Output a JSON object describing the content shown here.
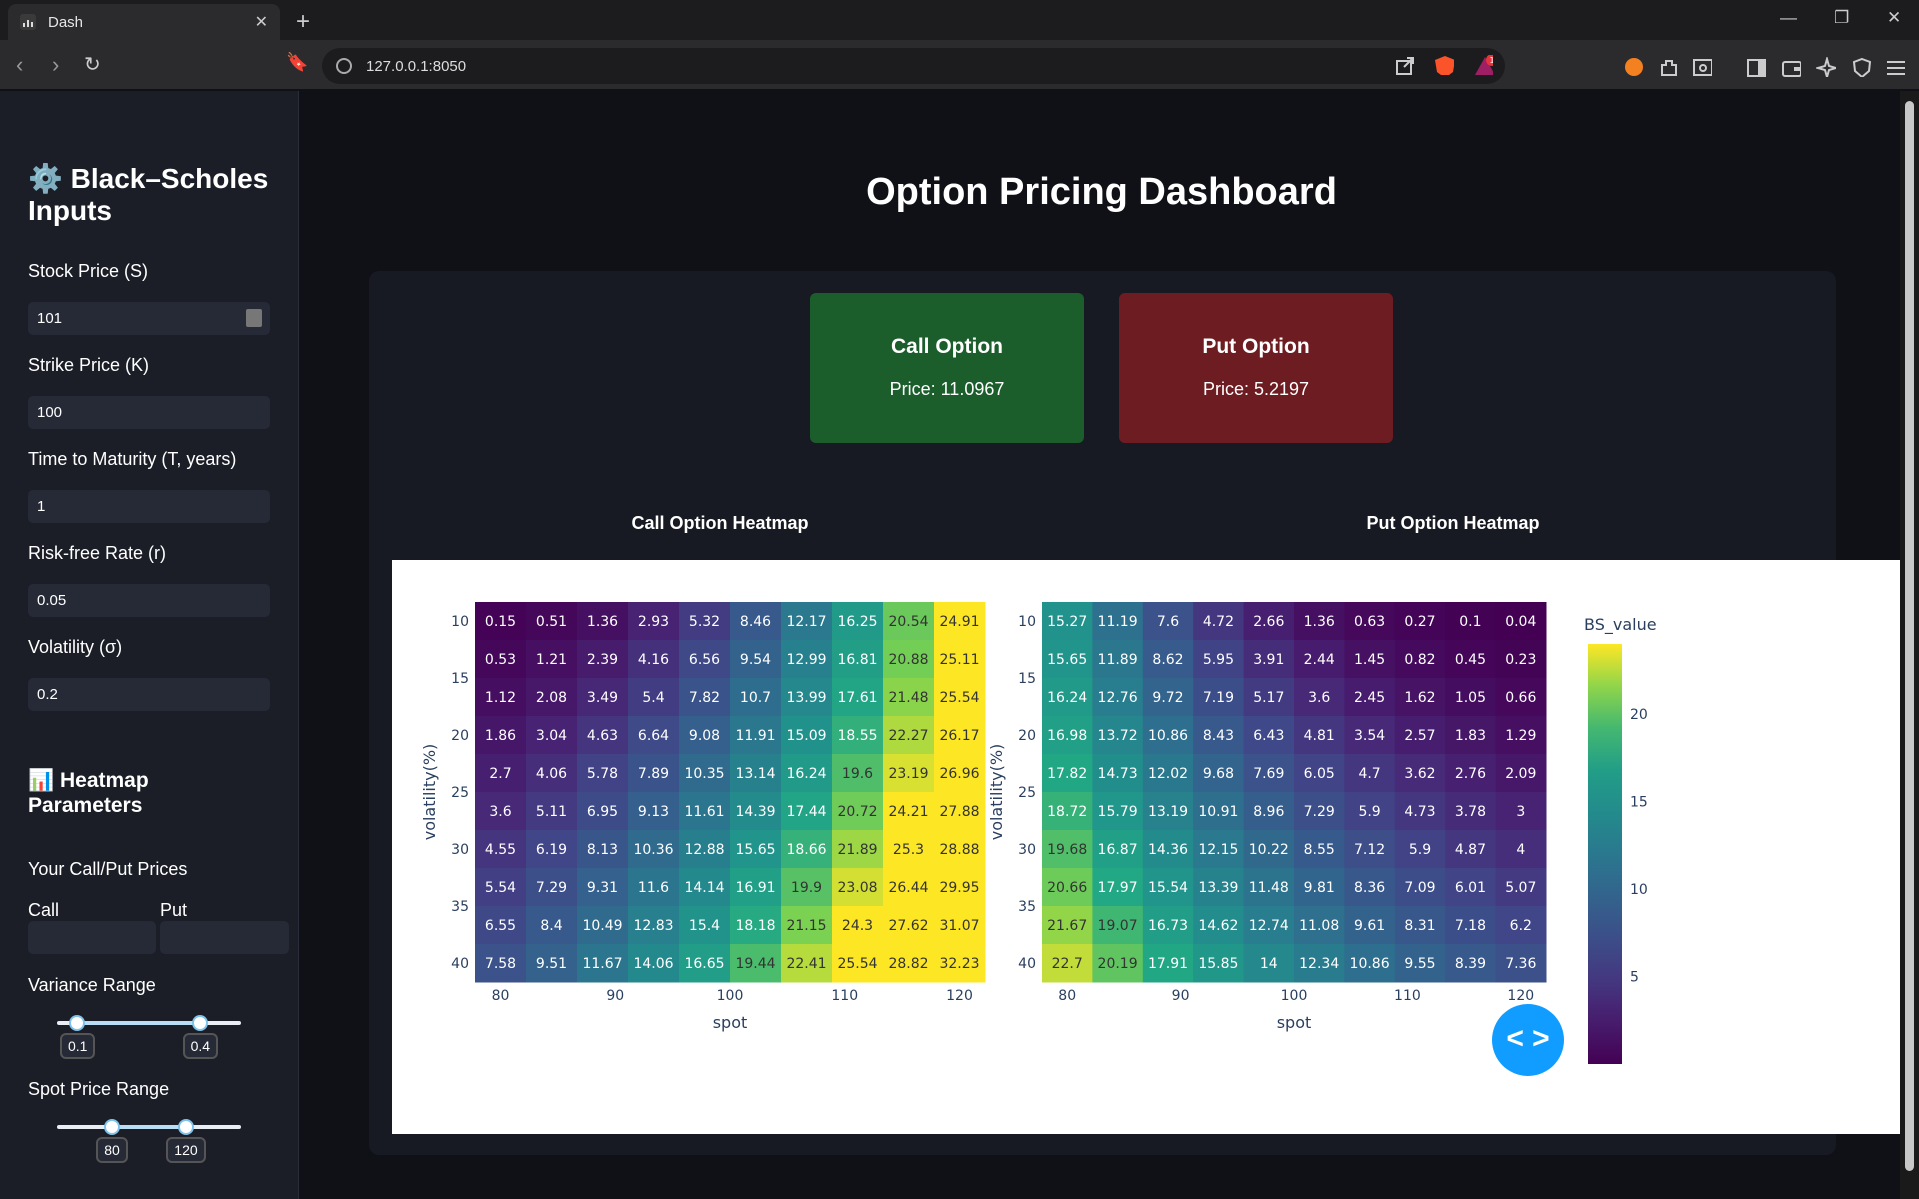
{
  "browser": {
    "tab_title": "Dash",
    "url": "127.0.0.1:8050",
    "notification_count": "1"
  },
  "sidebar": {
    "title": "⚙️ Black–Scholes Inputs",
    "fields": [
      {
        "label": "Stock Price (S)",
        "value": "101"
      },
      {
        "label": "Strike Price (K)",
        "value": "100"
      },
      {
        "label": "Time to Maturity (T, years)",
        "value": "1"
      },
      {
        "label": "Risk-free Rate (r)",
        "value": "0.05"
      },
      {
        "label": "Volatility (σ)",
        "value": "0.2"
      }
    ],
    "heatmap_title": "📊 Heatmap Parameters",
    "your_prices_label": "Your Call/Put Prices",
    "call_label": "Call",
    "put_label": "Put",
    "variance_range_label": "Variance Range",
    "variance_range": {
      "low": "0.1",
      "high": "0.4",
      "min": 0.05,
      "max": 0.5
    },
    "spot_range_label": "Spot Price Range",
    "spot_range": {
      "low": "80",
      "high": "120",
      "min": 50,
      "max": 150
    }
  },
  "main": {
    "title": "Option Pricing Dashboard",
    "call_card": {
      "title": "Call Option",
      "price": "Price: 11.0967",
      "color": "#1b5e2c"
    },
    "put_card": {
      "title": "Put Option",
      "price": "Price: 5.2197",
      "color": "#6d1c22"
    },
    "call_heatmap_title": "Call Option Heatmap",
    "put_heatmap_title": "Put Option Heatmap"
  },
  "chart_data": [
    {
      "type": "heatmap",
      "title": "Call Option Heatmap",
      "xlabel": "spot",
      "ylabel": "volatility(%)",
      "x_ticks": [
        "80",
        "90",
        "100",
        "110",
        "120"
      ],
      "y_ticks": [
        "10",
        "15",
        "20",
        "25",
        "30",
        "35",
        "40"
      ],
      "colorscale": "viridis",
      "zlim": [
        0,
        24
      ],
      "values": [
        [
          0.15,
          0.51,
          1.36,
          2.93,
          5.32,
          8.46,
          12.17,
          16.25,
          20.54,
          24.91
        ],
        [
          0.53,
          1.21,
          2.39,
          4.16,
          6.56,
          9.54,
          12.99,
          16.81,
          20.88,
          25.11
        ],
        [
          1.12,
          2.08,
          3.49,
          5.4,
          7.82,
          10.7,
          13.99,
          17.61,
          21.48,
          25.54
        ],
        [
          1.86,
          3.04,
          4.63,
          6.64,
          9.08,
          11.91,
          15.09,
          18.55,
          22.27,
          26.17
        ],
        [
          2.7,
          4.06,
          5.78,
          7.89,
          10.35,
          13.14,
          16.24,
          19.6,
          23.19,
          26.96
        ],
        [
          3.6,
          5.11,
          6.95,
          9.13,
          11.61,
          14.39,
          17.44,
          20.72,
          24.21,
          27.88
        ],
        [
          4.55,
          6.19,
          8.13,
          10.36,
          12.88,
          15.65,
          18.66,
          21.89,
          25.3,
          28.88
        ],
        [
          5.54,
          7.29,
          9.31,
          11.6,
          14.14,
          16.91,
          19.9,
          23.08,
          26.44,
          29.95
        ],
        [
          6.55,
          8.4,
          10.49,
          12.83,
          15.4,
          18.18,
          21.15,
          24.3,
          27.62,
          31.07
        ],
        [
          7.58,
          9.51,
          11.67,
          14.06,
          16.65,
          19.44,
          22.41,
          25.54,
          28.82,
          32.23
        ]
      ]
    },
    {
      "type": "heatmap",
      "title": "Put Option Heatmap",
      "xlabel": "spot",
      "ylabel": "volatility(%)",
      "x_ticks": [
        "80",
        "90",
        "100",
        "110",
        "120"
      ],
      "y_ticks": [
        "10",
        "15",
        "20",
        "25",
        "30",
        "35",
        "40"
      ],
      "colorscale": "viridis",
      "zlim": [
        0,
        24
      ],
      "colorbar_title": "BS_value",
      "colorbar_ticks": [
        "20",
        "15",
        "10",
        "5"
      ],
      "values": [
        [
          15.27,
          11.19,
          7.6,
          4.72,
          2.66,
          1.36,
          0.63,
          0.27,
          0.1,
          0.04
        ],
        [
          15.65,
          11.89,
          8.62,
          5.95,
          3.91,
          2.44,
          1.45,
          0.82,
          0.45,
          0.23
        ],
        [
          16.24,
          12.76,
          9.72,
          7.19,
          5.17,
          3.6,
          2.45,
          1.62,
          1.05,
          0.66
        ],
        [
          16.98,
          13.72,
          10.86,
          8.43,
          6.43,
          4.81,
          3.54,
          2.57,
          1.83,
          1.29
        ],
        [
          17.82,
          14.73,
          12.02,
          9.68,
          7.69,
          6.05,
          4.7,
          3.62,
          2.76,
          2.09
        ],
        [
          18.72,
          15.79,
          13.19,
          10.91,
          8.96,
          7.29,
          5.9,
          4.73,
          3.78,
          3
        ],
        [
          19.68,
          16.87,
          14.36,
          12.15,
          10.22,
          8.55,
          7.12,
          5.9,
          4.87,
          4
        ],
        [
          20.66,
          17.97,
          15.54,
          13.39,
          11.48,
          9.81,
          8.36,
          7.09,
          6.01,
          5.07
        ],
        [
          21.67,
          19.07,
          16.73,
          14.62,
          12.74,
          11.08,
          9.61,
          8.31,
          7.18,
          6.2
        ],
        [
          22.7,
          20.19,
          17.91,
          15.85,
          14,
          12.34,
          10.86,
          9.55,
          8.39,
          7.36
        ]
      ]
    }
  ]
}
